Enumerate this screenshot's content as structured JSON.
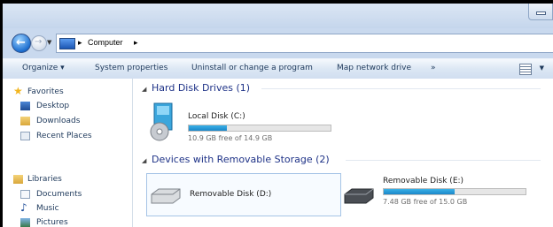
{
  "address": {
    "crumbs": [
      "Computer"
    ],
    "separator": "▸"
  },
  "toolbar": {
    "organize": "Organize ▾",
    "system_properties": "System properties",
    "uninstall": "Uninstall or change a program",
    "map_drive": "Map network drive",
    "more": "»"
  },
  "sidebar": {
    "favorites": "Favorites",
    "favorites_items": [
      "Desktop",
      "Downloads",
      "Recent Places"
    ],
    "libraries": "Libraries",
    "libraries_items": [
      "Documents",
      "Music",
      "Pictures"
    ]
  },
  "groups": {
    "hdd": "Hard Disk Drives (1)",
    "removable": "Devices with Removable Storage (2)"
  },
  "drives": [
    {
      "name": "Local Disk (C:)",
      "free": "10.9 GB free of 14.9 GB",
      "used_fraction": 0.27
    },
    {
      "name": "Removable Disk (D:)"
    },
    {
      "name": "Removable Disk (E:)",
      "free": "7.48 GB free of 15.0 GB",
      "used_fraction": 0.5
    }
  ],
  "colors": {
    "accent": "#1b86c8",
    "group_text": "#1e3287"
  }
}
